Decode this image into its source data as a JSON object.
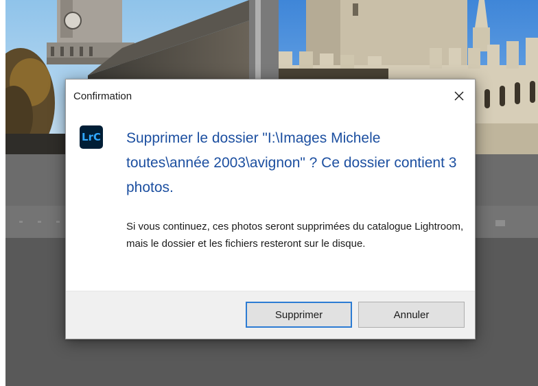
{
  "dialog": {
    "title": "Confirmation",
    "close_icon": "close-icon",
    "app_icon_label": "LrC",
    "main_instruction": "Supprimer le dossier \"I:\\Images Michele toutes\\année 2003\\avignon\" ? Ce dossier contient 3 photos.",
    "content": "Si vous continuez, ces photos seront supprimées du catalogue Lightroom, mais le dossier et les fichiers resteront sur le disque.",
    "buttons": {
      "primary_label": "Supprimer",
      "secondary_label": "Annuler"
    }
  },
  "colors": {
    "instruction_blue": "#1c4fa0",
    "lrc_icon_bg": "#001e36",
    "lrc_icon_text": "#31a8ff",
    "default_button_border": "#2b7bd3"
  }
}
